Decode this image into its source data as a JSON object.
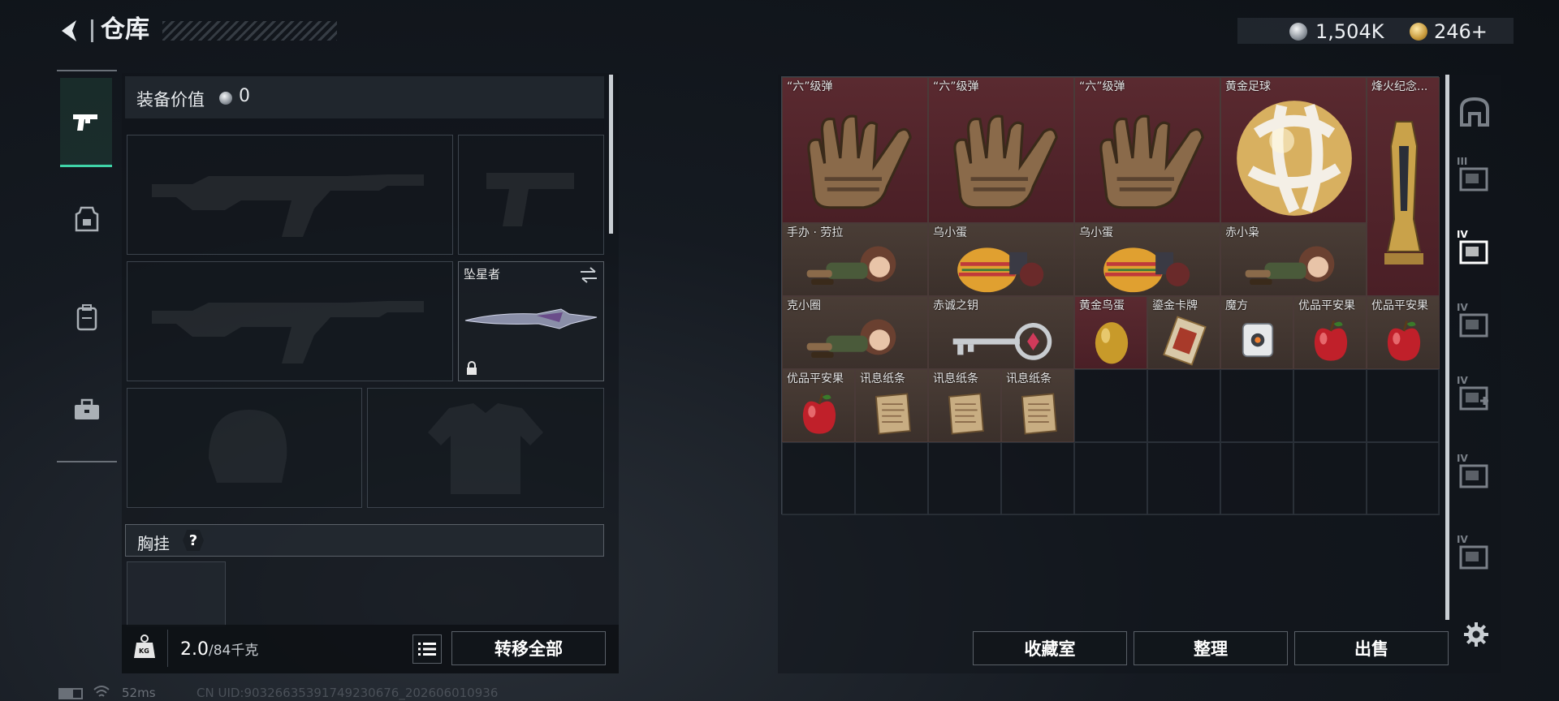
{
  "header": {
    "title": "仓库",
    "currency1": "1,504K",
    "currency2": "246+"
  },
  "left_nav": [
    {
      "name": "weapon",
      "icon": "pistol-icon",
      "active": true
    },
    {
      "name": "armor",
      "icon": "armor-icon",
      "active": false
    },
    {
      "name": "backpack",
      "icon": "backpack-icon",
      "active": false
    },
    {
      "name": "toolbox",
      "icon": "toolbox-icon",
      "active": false
    }
  ],
  "equipment": {
    "value_label": "装备价值",
    "value": "0",
    "melee_name": "坠星者",
    "chest_label": "胸挂",
    "chest_help": "?"
  },
  "bottom": {
    "weight_current": "2.0",
    "weight_max": "/84千克",
    "weight_icon_text": "KG",
    "transfer_all": "转移全部"
  },
  "storage": {
    "items": [
      {
        "label": "“六”级弹",
        "kind": "hand"
      },
      {
        "label": "“六”级弹",
        "kind": "hand"
      },
      {
        "label": "“六”级弹",
        "kind": "hand"
      },
      {
        "label": "黄金足球",
        "kind": "ball"
      },
      {
        "label": "烽火纪念...",
        "kind": "trophy"
      },
      {
        "label": "手办 · 劳拉",
        "kind": "figure"
      },
      {
        "label": "乌小蛋",
        "kind": "egg"
      },
      {
        "label": "乌小蛋",
        "kind": "egg"
      },
      {
        "label": "赤小枭",
        "kind": "figure"
      },
      {
        "label": "克小圈",
        "kind": "figure"
      },
      {
        "label": "赤诚之钥",
        "kind": "key"
      },
      {
        "label": "黄金鸟蛋",
        "kind": "goldegg"
      },
      {
        "label": "鎏金卡牌",
        "kind": "card"
      },
      {
        "label": "魔方",
        "kind": "cube"
      },
      {
        "label": "优品平安果",
        "kind": "apple"
      },
      {
        "label": "优品平安果",
        "kind": "apple"
      },
      {
        "label": "优品平安果",
        "kind": "apple"
      },
      {
        "label": "讯息纸条",
        "kind": "paper"
      },
      {
        "label": "讯息纸条",
        "kind": "paper"
      },
      {
        "label": "讯息纸条",
        "kind": "paper"
      }
    ]
  },
  "right_tabs": [
    {
      "name": "home",
      "icon": "home-icon",
      "tier": ""
    },
    {
      "name": "container-3",
      "icon": "container-icon",
      "tier": "III"
    },
    {
      "name": "container-4-active",
      "icon": "container-icon",
      "tier": "IV"
    },
    {
      "name": "container-4b",
      "icon": "container-icon",
      "tier": "IV"
    },
    {
      "name": "container-4-plus",
      "icon": "container-plus-icon",
      "tier": "IV"
    },
    {
      "name": "container-4c",
      "icon": "container-icon",
      "tier": "IV"
    },
    {
      "name": "container-4d",
      "icon": "container-icon",
      "tier": "IV"
    }
  ],
  "actions": {
    "collection": "收藏室",
    "sort": "整理",
    "sell": "出售"
  },
  "status": {
    "latency": "52ms",
    "uid": "CN UID:90326635391749230676_202606010936"
  },
  "colors": {
    "accent": "#3fd4a8",
    "item_red": "#5a2a30",
    "item_brown": "#4a3d36"
  }
}
